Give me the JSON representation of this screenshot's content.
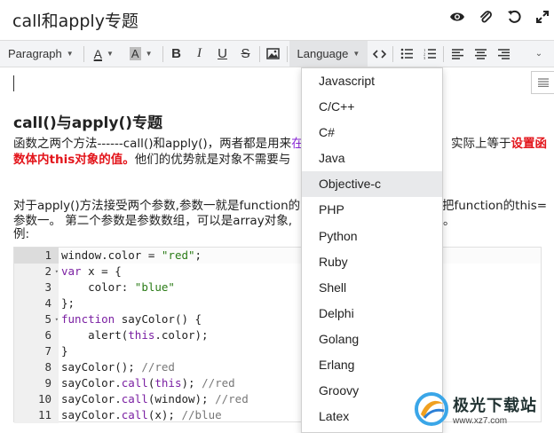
{
  "title": "call和apply专题",
  "title_icons": [
    "eye-icon",
    "paperclip-icon",
    "undo-icon",
    "fullscreen-icon"
  ],
  "toolbar": {
    "paragraph": "Paragraph",
    "font_color": "A",
    "bg_color": "A",
    "bold": "B",
    "italic": "I",
    "underline": "U",
    "strike": "S",
    "language": "Language"
  },
  "content": {
    "heading": "call()与apply()专题",
    "p1_a": "函数之两个方法------call()和apply()，两者都是用来",
    "p1_purple": "在",
    "p1_b": "实际上等于",
    "p1_red1": "设置函",
    "p2_red": "数体内this对象的值。",
    "p2_b": "他们的优势就是对象不需要与",
    "p3_a": "对于apply()方法接受两个参数,参数一就是function的",
    "p3_b": "把function的this=",
    "p4_a": "参数一。 第二个参数是参数数组，可以是array对象,",
    "p4_b": "。",
    "p5": "例:"
  },
  "code": {
    "lines": [
      {
        "num": "1",
        "fold": "",
        "parts": [
          [
            "",
            "window.color = "
          ],
          [
            "str",
            "\"red\""
          ],
          [
            "",
            ";"
          ]
        ]
      },
      {
        "num": "2",
        "fold": "▾",
        "parts": [
          [
            "kw",
            "var"
          ],
          [
            "",
            " x = {"
          ]
        ]
      },
      {
        "num": "3",
        "fold": "",
        "parts": [
          [
            "",
            "    color: "
          ],
          [
            "str",
            "\"blue\""
          ]
        ]
      },
      {
        "num": "4",
        "fold": "",
        "parts": [
          [
            "",
            "};"
          ]
        ]
      },
      {
        "num": "5",
        "fold": "▾",
        "parts": [
          [
            "kw",
            "function"
          ],
          [
            "",
            " sayColor() {"
          ]
        ]
      },
      {
        "num": "6",
        "fold": "",
        "parts": [
          [
            "",
            "    alert("
          ],
          [
            "kw",
            "this"
          ],
          [
            "",
            ".color);"
          ]
        ]
      },
      {
        "num": "7",
        "fold": "",
        "parts": [
          [
            "",
            "}"
          ]
        ]
      },
      {
        "num": "8",
        "fold": "",
        "parts": [
          [
            "",
            "sayColor(); "
          ],
          [
            "cmt",
            "//red"
          ]
        ]
      },
      {
        "num": "9",
        "fold": "",
        "parts": [
          [
            "",
            "sayColor."
          ],
          [
            "kw",
            "call"
          ],
          [
            "",
            "("
          ],
          [
            "kw",
            "this"
          ],
          [
            "",
            "); "
          ],
          [
            "cmt",
            "//red"
          ]
        ]
      },
      {
        "num": "10",
        "fold": "",
        "parts": [
          [
            "",
            "sayColor."
          ],
          [
            "kw",
            "call"
          ],
          [
            "",
            "(window); "
          ],
          [
            "cmt",
            "//red"
          ]
        ]
      },
      {
        "num": "11",
        "fold": "",
        "parts": [
          [
            "",
            "sayColor."
          ],
          [
            "kw",
            "call"
          ],
          [
            "",
            "(x); "
          ],
          [
            "cmt",
            "//blue"
          ]
        ]
      }
    ]
  },
  "languages": [
    "Javascript",
    "C/C++",
    "C#",
    "Java",
    "Objective-c",
    "PHP",
    "Python",
    "Ruby",
    "Shell",
    "Delphi",
    "Golang",
    "Erlang",
    "Groovy",
    "Latex"
  ],
  "hovered_language": "Objective-c",
  "watermark": {
    "cn": "极光下载站",
    "url": "www.xz7.com"
  },
  "colors": {
    "accent_red": "#e3151b",
    "purple": "#8c2bd9",
    "toolbar_bg": "#f3f4f6",
    "hover": "#e8e9eb"
  }
}
